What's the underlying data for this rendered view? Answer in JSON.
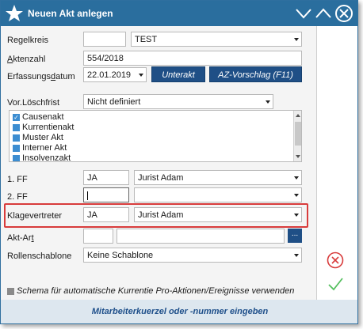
{
  "window": {
    "title": "Neuen Akt anlegen"
  },
  "fields": {
    "regelkreis": {
      "label": "Regelkreis",
      "code": "",
      "value": "TEST"
    },
    "aktenzahl": {
      "label_pre": "",
      "label_key": "A",
      "label_post": "ktenzahl",
      "value": "554/2018"
    },
    "erfassungsdatum": {
      "label_pre": "Erfassungs",
      "label_key": "d",
      "label_post": "atum",
      "value": "22.01.2019"
    },
    "vor_loeschfrist": {
      "label": "Vor.Löschfrist",
      "value": "Nicht definiert"
    },
    "ff1": {
      "label": "1. FF",
      "code": "JA",
      "value": "Jurist Adam"
    },
    "ff2": {
      "label": "2. FF",
      "code": "",
      "value": ""
    },
    "klagevertreter": {
      "label": "Klagevertreter",
      "code": "JA",
      "value": "Jurist Adam"
    },
    "akt_art": {
      "label_pre": "Akt-Ar",
      "label_key": "t",
      "label_post": "",
      "code": "",
      "value": ""
    },
    "rollenschablone": {
      "label": "Rollenschablone",
      "value": "Keine Schablone"
    }
  },
  "buttons": {
    "unterakt": "Unterakt",
    "az_vorschlag": "AZ-Vorschlag (F11)",
    "akt_art_more": "..."
  },
  "akt_types": [
    {
      "label": "Causenakt",
      "checked": true
    },
    {
      "label": "Kurrentienakt",
      "checked": false
    },
    {
      "label": "Muster Akt",
      "checked": false
    },
    {
      "label": "Interner Akt",
      "checked": false
    },
    {
      "label": "Insolvenzakt",
      "checked": false
    }
  ],
  "schema": {
    "label": "Schema für automatische Kurrentie Pro-Aktionen/Ereignisse verwenden"
  },
  "statusbar": {
    "text": "Mitarbeiterkuerzel oder -nummer eingeben"
  },
  "colors": {
    "titlebar": "#2a6e9e",
    "accent_button": "#1f4f86",
    "highlight": "#d83b3b",
    "cancel": "#d83b3b",
    "ok": "#56c060"
  },
  "icons": {
    "title": "star-icon",
    "minimize": "chevron-down-icon",
    "maximize": "chevron-up-icon",
    "close": "close-circle-icon",
    "cancel": "cancel-circle-icon",
    "ok": "checkmark-icon"
  }
}
